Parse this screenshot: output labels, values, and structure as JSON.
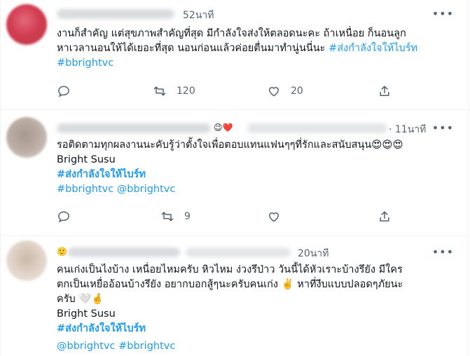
{
  "tweets": [
    {
      "time": "52นาที",
      "lines": [
        "งานก็สำคัญ แต่สุขภาพสำคัญที่สุด มีกำลังใจส่งให้ตลอดนะคะ ถ้าเหนื่อย ก็นอนลูก",
        "หาเวลานอนให้ได้เยอะที่สุด นอนก่อนแล้วค่อยตื่นมาทำนู่นนี่นะ"
      ],
      "hashtag_inline": "#ส่งกำลังใจให้ไบร์ท",
      "hashtag_line": "#bbrightvc",
      "replies": "",
      "retweets": "120",
      "likes": "20"
    },
    {
      "time": "· 11นาที",
      "lines": [
        "รอติดตามทุกผลงานนะคับรู้ว่าตั้งใจเพื่อตอบแทนแฟนๆๆที่รักและสนับสนุน😍😍😍"
      ],
      "signature": "Bright Susu",
      "hashtag": "#ส่งกำลังใจให้ไบร์ท",
      "tags": [
        "#bbrightvc",
        "@bbrightvc"
      ],
      "replies": "",
      "retweets": "9",
      "likes": ""
    },
    {
      "time": "20นาที",
      "lines": [
        "คนเก่งเป็นไงบ้าง  เหนื่อยไหมครับ  หิวไหม   ง่วงรึป่าว วันนี้ได้หัวเราะบ้างรึยัง มีใคร",
        "ตกเป็นเหยื่ออ้อนบ้างรึยัง อยากบอกสู้ๆนะครับคนเก่ง ✌️  หาที่งีบแบบปลอดๆภัยนะ",
        "ครับ 🤍🤞"
      ],
      "signature": "Bright Susu",
      "hashtag": "#ส่งกำลังใจให้ไบร์ท",
      "tags": [
        "@bbrightvc",
        "#bbrightvc"
      ]
    }
  ],
  "icons": [
    "reply-icon",
    "retweet-icon",
    "like-icon",
    "share-icon",
    "more-icon"
  ],
  "colors": {
    "link": "#1d9bf0",
    "muted": "#536471",
    "text": "#0f1419",
    "border": "#eff3f4"
  }
}
